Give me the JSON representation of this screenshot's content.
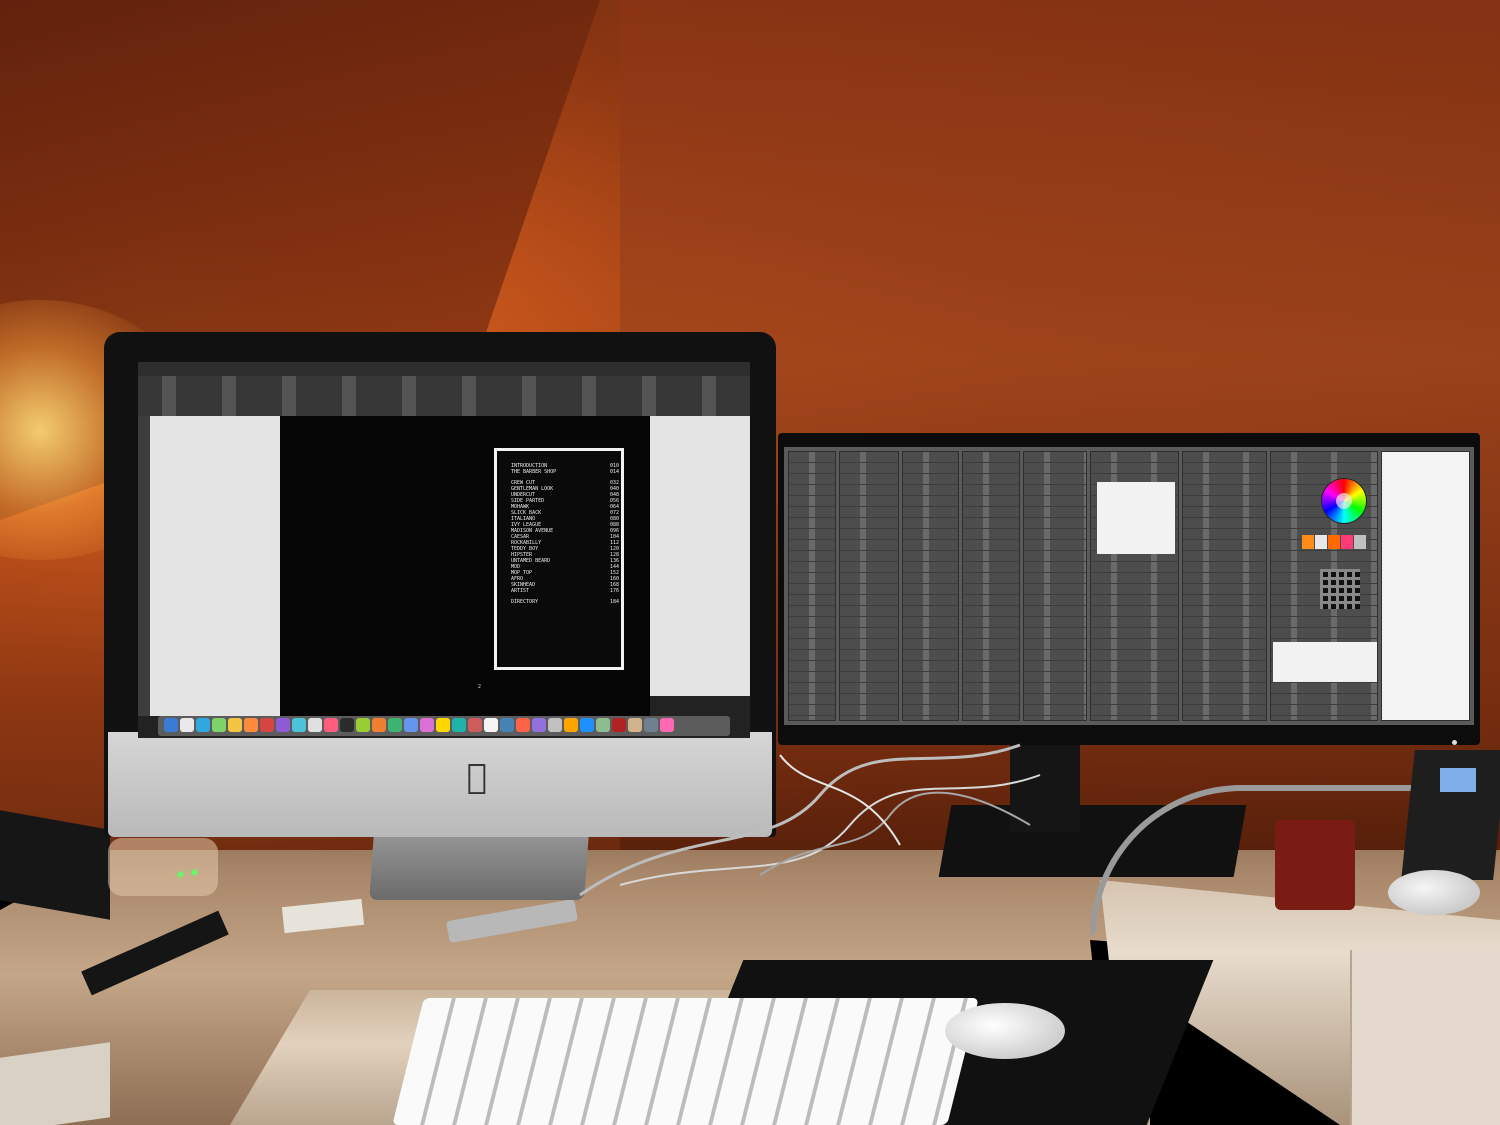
{
  "imac_screen": {
    "toc_top": [
      {
        "label": "INTRODUCTION",
        "page": "010"
      },
      {
        "label": "THE BARBER SHOP",
        "page": "014"
      }
    ],
    "toc_main": [
      {
        "label": "CREW CUT",
        "page": "032"
      },
      {
        "label": "GENTLEMAN LOOK",
        "page": "040"
      },
      {
        "label": "UNDERCUT",
        "page": "048"
      },
      {
        "label": "SIDE PARTED",
        "page": "056"
      },
      {
        "label": "MOHAWK",
        "page": "064"
      },
      {
        "label": "SLICK BACK",
        "page": "072"
      },
      {
        "label": "ITALIANO",
        "page": "080"
      },
      {
        "label": "IVY LEAGUE",
        "page": "088"
      },
      {
        "label": "MADISON AVENUE",
        "page": "096"
      },
      {
        "label": "CAESAR",
        "page": "104"
      },
      {
        "label": "ROCKABILLY",
        "page": "112"
      },
      {
        "label": "TEDDY BOY",
        "page": "120"
      },
      {
        "label": "HIPSTER",
        "page": "128"
      },
      {
        "label": "UNTAMED BEARD",
        "page": "136"
      },
      {
        "label": "MOD",
        "page": "144"
      },
      {
        "label": "MOP TOP",
        "page": "152"
      },
      {
        "label": "AFRO",
        "page": "160"
      },
      {
        "label": "SKINHEAD",
        "page": "168"
      },
      {
        "label": "ARTIST",
        "page": "176"
      }
    ],
    "toc_bottom": [
      {
        "label": "DIRECTORY",
        "page": "184"
      }
    ],
    "folio": "2",
    "dock_colors": [
      "#3a7bd5",
      "#e9e9e9",
      "#2fa8e0",
      "#7fd36b",
      "#f4c542",
      "#ff8a3d",
      "#d64541",
      "#8e5bd6",
      "#4cc3d9",
      "#e0e0e0",
      "#ff5e7e",
      "#2b2b2b",
      "#9acd32",
      "#f08030",
      "#3cb371",
      "#6495ed",
      "#da70d6",
      "#ffd700",
      "#20b2aa",
      "#cd5c5c",
      "#f5f5f5",
      "#4682b4",
      "#ff6347",
      "#9370db",
      "#c0c0c0",
      "#ffa500",
      "#1e90ff",
      "#8fbc8f",
      "#b22222",
      "#d2b48c",
      "#708090",
      "#ff69b4"
    ]
  },
  "right_screen": {
    "accent_swatches": [
      "#ff8c1a",
      "#e8e8e8",
      "#ff6a00",
      "#ff3b7a",
      "#c0c0c0"
    ]
  }
}
